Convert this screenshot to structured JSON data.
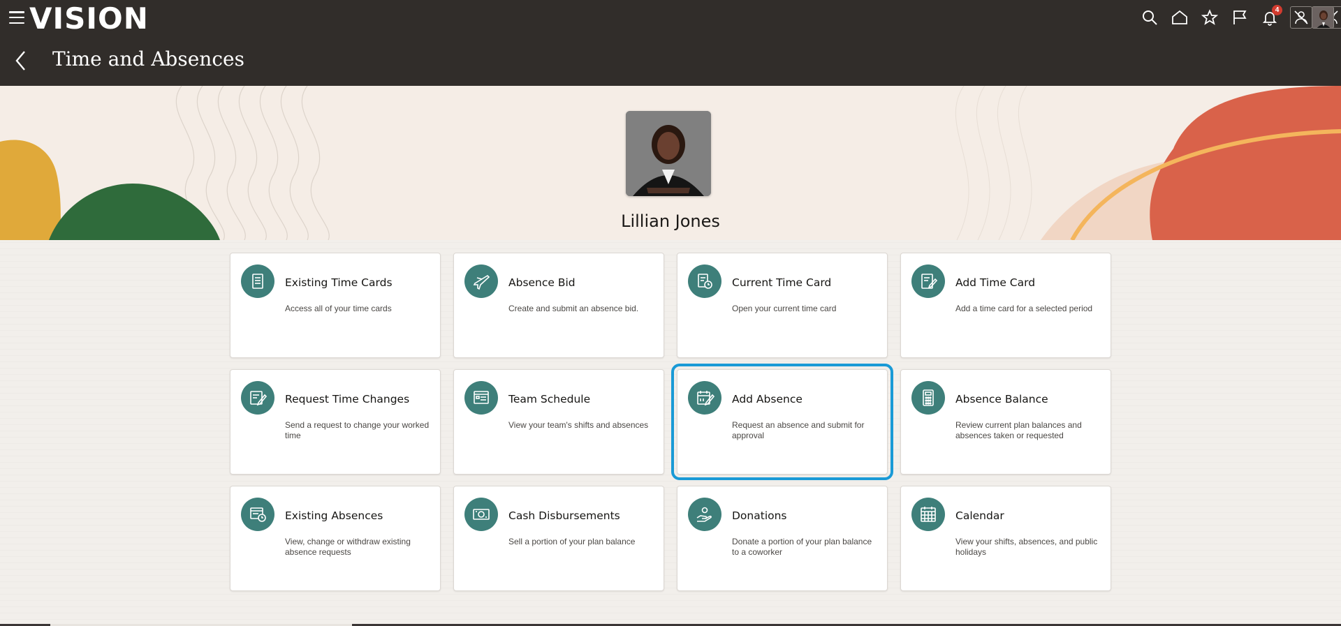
{
  "header": {
    "brand": "VISION",
    "page_title": "Time and Absences",
    "notification_count": "4",
    "icons": [
      "hamburger-menu-icon",
      "search-icon",
      "home-icon",
      "favorites-star-icon",
      "flag-icon",
      "notifications-bell-icon",
      "person-action-icon",
      "person-settings-icon",
      "user-avatar"
    ]
  },
  "profile": {
    "name": "Lillian Jones"
  },
  "tiles": [
    {
      "title": "Existing Time Cards",
      "desc": "Access all of your time cards",
      "icon": "document-list-icon"
    },
    {
      "title": "Absence Bid",
      "desc": "Create and submit an absence bid.",
      "icon": "airplane-icon"
    },
    {
      "title": "Current Time Card",
      "desc": "Open your current time card",
      "icon": "timecard-clock-icon"
    },
    {
      "title": "Add Time Card",
      "desc": "Add a time card for a selected period",
      "icon": "document-edit-icon"
    },
    {
      "title": "Request Time Changes",
      "desc": "Send a request to change your worked time",
      "icon": "document-pencil-icon"
    },
    {
      "title": "Team Schedule",
      "desc": "View your team's shifts and absences",
      "icon": "schedule-board-icon"
    },
    {
      "title": "Add Absence",
      "desc": "Request an absence and submit for approval",
      "icon": "calendar-edit-icon"
    },
    {
      "title": "Absence Balance",
      "desc": "Review current plan balances and absences taken or requested",
      "icon": "calculator-icon"
    },
    {
      "title": "Existing Absences",
      "desc": "View, change or withdraw existing absence requests",
      "icon": "absence-clock-icon"
    },
    {
      "title": "Cash Disbursements",
      "desc": "Sell a portion of your plan balance",
      "icon": "cash-icon"
    },
    {
      "title": "Donations",
      "desc": "Donate a portion of your plan balance to a coworker",
      "icon": "donation-hand-icon"
    },
    {
      "title": "Calendar",
      "desc": "View your shifts, absences, and public holidays",
      "icon": "calendar-grid-icon"
    }
  ],
  "selected_tile": "Add Absence",
  "colors": {
    "header_bg": "#312d2a",
    "icon_circle": "#3e7f7a",
    "selection_outline": "#1a9ad6",
    "badge": "#d23b2f"
  }
}
